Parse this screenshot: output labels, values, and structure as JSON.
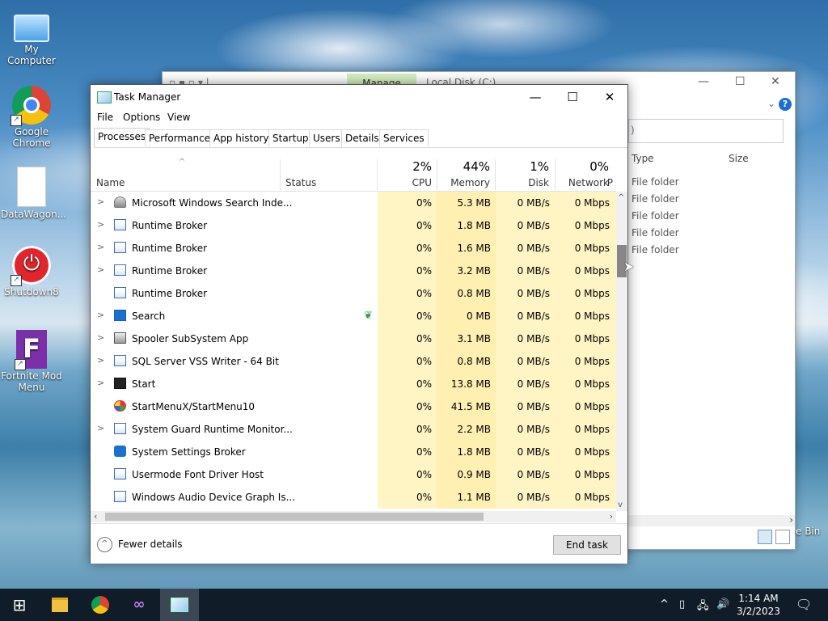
{
  "desktop": {
    "icons": [
      {
        "label": "My Computer"
      },
      {
        "label": "Google Chrome"
      },
      {
        "label": "DataWagon..."
      },
      {
        "label": "Shutdown8"
      },
      {
        "label": "Fortnite Mod Menu"
      }
    ]
  },
  "explorer": {
    "manage_tab": "Manage",
    "title": "Local Disk (C:)",
    "columns": {
      "type": "Type",
      "size": "Size"
    },
    "address_fragment": ")",
    "rows": [
      "File folder",
      "File folder",
      "File folder",
      "File folder",
      "File folder"
    ],
    "recycle_fragment": "e Bin"
  },
  "taskmgr": {
    "title": "Task Manager",
    "menu": [
      "File",
      "Options",
      "View"
    ],
    "tabs": [
      "Processes",
      "Performance",
      "App history",
      "Startup",
      "Users",
      "Details",
      "Services"
    ],
    "active_tab": "Processes",
    "columns": {
      "name": "Name",
      "status": "Status",
      "cpu": {
        "pct": "2%",
        "label": "CPU"
      },
      "memory": {
        "pct": "44%",
        "label": "Memory"
      },
      "disk": {
        "pct": "1%",
        "label": "Disk"
      },
      "network": {
        "pct": "0%",
        "label": "Network"
      },
      "power_fragment": "P"
    },
    "processes": [
      {
        "name": "Microsoft Windows Search Inde...",
        "expand": true,
        "cpu": "0%",
        "memory": "5.3 MB",
        "disk": "0 MB/s",
        "network": "0 Mbps",
        "icon": "search-indexer-icon"
      },
      {
        "name": "Runtime Broker",
        "expand": true,
        "cpu": "0%",
        "memory": "1.8 MB",
        "disk": "0 MB/s",
        "network": "0 Mbps",
        "icon": "app-window-icon"
      },
      {
        "name": "Runtime Broker",
        "expand": true,
        "cpu": "0%",
        "memory": "1.6 MB",
        "disk": "0 MB/s",
        "network": "0 Mbps",
        "icon": "app-window-icon"
      },
      {
        "name": "Runtime Broker",
        "expand": true,
        "cpu": "0%",
        "memory": "3.2 MB",
        "disk": "0 MB/s",
        "network": "0 Mbps",
        "icon": "app-window-icon"
      },
      {
        "name": "Runtime Broker",
        "expand": false,
        "cpu": "0%",
        "memory": "0.8 MB",
        "disk": "0 MB/s",
        "network": "0 Mbps",
        "icon": "app-window-icon"
      },
      {
        "name": "Search",
        "expand": true,
        "cpu": "0%",
        "memory": "0 MB",
        "disk": "0 MB/s",
        "network": "0 Mbps",
        "icon": "search-icon",
        "suspended": true
      },
      {
        "name": "Spooler SubSystem App",
        "expand": true,
        "cpu": "0%",
        "memory": "3.1 MB",
        "disk": "0 MB/s",
        "network": "0 Mbps",
        "icon": "printer-icon"
      },
      {
        "name": "SQL Server VSS Writer - 64 Bit",
        "expand": true,
        "cpu": "0%",
        "memory": "0.8 MB",
        "disk": "0 MB/s",
        "network": "0 Mbps",
        "icon": "app-window-icon"
      },
      {
        "name": "Start",
        "expand": true,
        "cpu": "0%",
        "memory": "13.8 MB",
        "disk": "0 MB/s",
        "network": "0 Mbps",
        "icon": "start-icon"
      },
      {
        "name": "StartMenuX/StartMenu10",
        "expand": false,
        "cpu": "0%",
        "memory": "41.5 MB",
        "disk": "0 MB/s",
        "network": "0 Mbps",
        "icon": "startmenu-icon"
      },
      {
        "name": "System Guard Runtime Monitor...",
        "expand": true,
        "cpu": "0%",
        "memory": "2.2 MB",
        "disk": "0 MB/s",
        "network": "0 Mbps",
        "icon": "app-window-icon"
      },
      {
        "name": "System Settings Broker",
        "expand": false,
        "cpu": "0%",
        "memory": "1.8 MB",
        "disk": "0 MB/s",
        "network": "0 Mbps",
        "icon": "gear-icon"
      },
      {
        "name": "Usermode Font Driver Host",
        "expand": false,
        "cpu": "0%",
        "memory": "0.9 MB",
        "disk": "0 MB/s",
        "network": "0 Mbps",
        "icon": "app-window-icon"
      },
      {
        "name": "Windows Audio Device Graph Is...",
        "expand": false,
        "cpu": "0%",
        "memory": "1.1 MB",
        "disk": "0 MB/s",
        "network": "0 Mbps",
        "icon": "app-window-icon"
      }
    ],
    "footer": {
      "fewer_details": "Fewer details",
      "end_task": "End task"
    }
  },
  "taskbar": {
    "clock": {
      "time": "1:14 AM",
      "date": "3/2/2023"
    }
  },
  "colors": {
    "cpu_column_bg": "#fff4c4",
    "memory_column_bg": "#ffefb0",
    "taskbar_bg": "#101c28"
  }
}
